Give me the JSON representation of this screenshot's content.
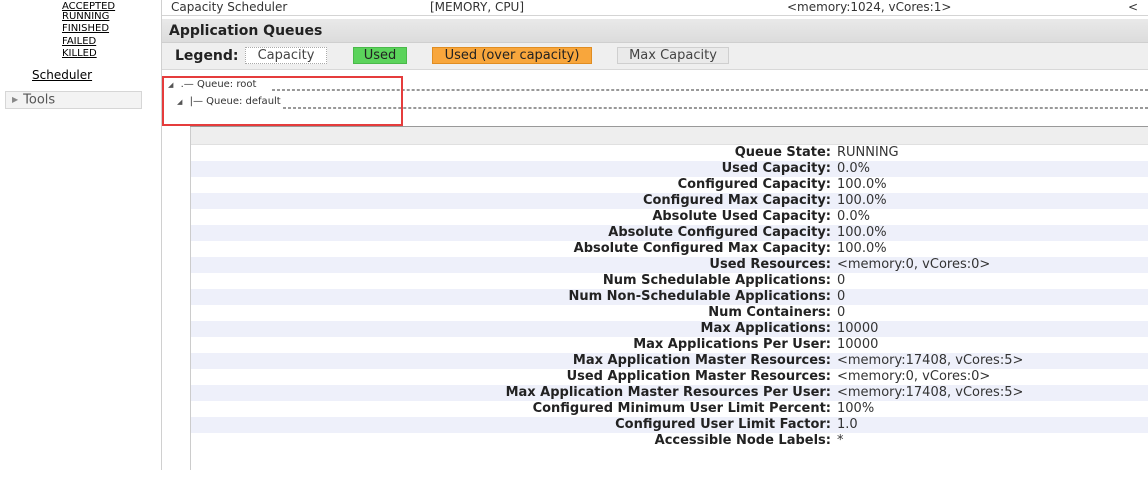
{
  "nav": {
    "app_states": [
      "ACCEPTED",
      "RUNNING",
      "FINISHED",
      "FAILED",
      "KILLED"
    ],
    "scheduler_link": "Scheduler",
    "tools_label": "Tools"
  },
  "scheduler_row": {
    "type": "Capacity Scheduler",
    "resource_types": "[MEMORY, CPU]",
    "min_allocation": "<memory:1024, vCores:1>",
    "truncated": "<"
  },
  "queues": {
    "title": "Application Queues",
    "legend": {
      "label": "Legend:",
      "capacity": "Capacity",
      "used": "Used",
      "over": "Used (over capacity)",
      "max": "Max Capacity"
    },
    "colors": {
      "used": "#5bd35b",
      "over": "#f8a63c",
      "highlight": "#e53c3c"
    },
    "root_label": "Queue: root",
    "default_label": "Queue: default"
  },
  "details": [
    {
      "label": "Queue State:",
      "value": "RUNNING"
    },
    {
      "label": "Used Capacity:",
      "value": "0.0%"
    },
    {
      "label": "Configured Capacity:",
      "value": "100.0%"
    },
    {
      "label": "Configured Max Capacity:",
      "value": "100.0%"
    },
    {
      "label": "Absolute Used Capacity:",
      "value": "0.0%"
    },
    {
      "label": "Absolute Configured Capacity:",
      "value": "100.0%"
    },
    {
      "label": "Absolute Configured Max Capacity:",
      "value": "100.0%"
    },
    {
      "label": "Used Resources:",
      "value": "<memory:0, vCores:0>"
    },
    {
      "label": "Num Schedulable Applications:",
      "value": "0"
    },
    {
      "label": "Num Non-Schedulable Applications:",
      "value": "0"
    },
    {
      "label": "Num Containers:",
      "value": "0"
    },
    {
      "label": "Max Applications:",
      "value": "10000"
    },
    {
      "label": "Max Applications Per User:",
      "value": "10000"
    },
    {
      "label": "Max Application Master Resources:",
      "value": "<memory:17408, vCores:5>"
    },
    {
      "label": "Used Application Master Resources:",
      "value": "<memory:0, vCores:0>"
    },
    {
      "label": "Max Application Master Resources Per User:",
      "value": "<memory:17408, vCores:5>"
    },
    {
      "label": "Configured Minimum User Limit Percent:",
      "value": "100%"
    },
    {
      "label": "Configured User Limit Factor:",
      "value": "1.0"
    },
    {
      "label": "Accessible Node Labels:",
      "value": "*"
    }
  ]
}
